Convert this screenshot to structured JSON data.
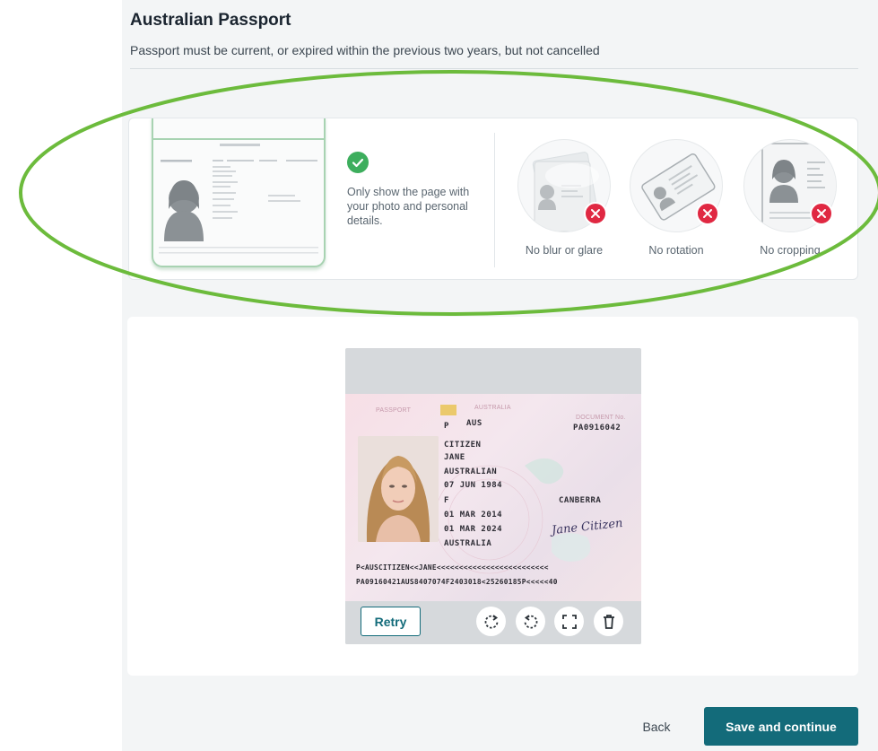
{
  "header": {
    "title": "Australian Passport",
    "subtitle": "Passport must be current, or expired within the previous two years, but not cancelled"
  },
  "guidance": {
    "good_text": "Only show the page with your photo and personal details.",
    "bad_items": [
      {
        "label": "No blur or glare",
        "icon": "blurred-passport-icon"
      },
      {
        "label": "No rotation",
        "icon": "rotated-passport-icon"
      },
      {
        "label": "No cropping",
        "icon": "cropped-passport-icon"
      }
    ],
    "colors": {
      "ok": "#3dae5d",
      "error": "#e02842"
    }
  },
  "passport": {
    "header_left": "PASSPORT",
    "header_country": "AUSTRALIA",
    "doc_label": "DOCUMENT No.",
    "doc_number": "PA0916042",
    "type": "P",
    "code": "AUS",
    "surname": "CITIZEN",
    "given_names": "JANE",
    "nationality": "AUSTRALIAN",
    "dob": "07 JUN 1984",
    "sex": "F",
    "place_of_birth": "CANBERRA",
    "issued": "01 MAR 2014",
    "expires": "01 MAR 2024",
    "authority": "AUSTRALIA",
    "signature": "Jane Citizen",
    "mrz_line1": "P<AUSCITIZEN<<JANE<<<<<<<<<<<<<<<<<<<<<<<<<",
    "mrz_line2": "PA09160421AUS8407074F2403018<25260185P<<<<<40"
  },
  "preview_actions": {
    "retry_label": "Retry",
    "tools": [
      "rotate-right-icon",
      "rotate-left-icon",
      "fullscreen-icon",
      "delete-icon"
    ]
  },
  "footer": {
    "back_label": "Back",
    "save_label": "Save and continue",
    "brand_color": "#136b7a"
  },
  "annotation_color": "#6cbb3c"
}
